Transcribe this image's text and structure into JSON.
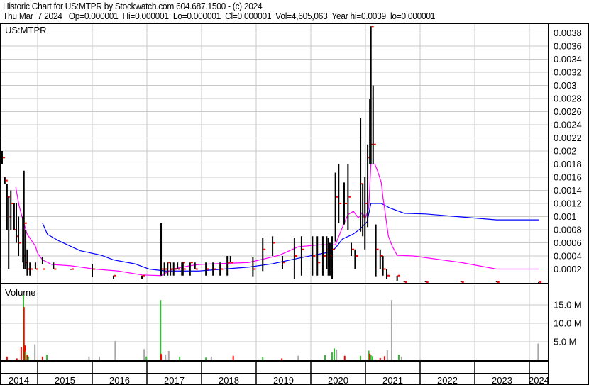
{
  "header": {
    "title": "Historic Chart for US:MTPR by Stockwatch.com 604.687.1500 - (c) 2024",
    "quote": "Thu Mar  7 2024   Op=0.000001  Hi=0.000001  Lo=0.000001  Cl=0.000001  Vol=4,605,063  Year hi=0.0039  lo=0.000001"
  },
  "colors": {
    "bar": "#000000",
    "close": "#ff0000",
    "ma_short": "#ff00ff",
    "ma_long": "#0000ff",
    "vol_up": "#33bb33",
    "vol_down": "#ff0000",
    "vol_flat": "#a8a8a8",
    "grid": "#c8c8c8"
  },
  "chart_data": [
    {
      "type": "bar",
      "title": "US:MTPR",
      "ylim": [
        0,
        0.0039
      ],
      "yticks": [
        "0.0002",
        "0.0004",
        "0.0006",
        "0.0008",
        "0.001",
        "0.0012",
        "0.0014",
        "0.0016",
        "0.0018",
        "0.002",
        "0.0022",
        "0.0024",
        "0.0026",
        "0.0028",
        "0.003",
        "0.0032",
        "0.0034",
        "0.0036",
        "0.0038"
      ],
      "xticks": [
        "2014",
        "2015",
        "2016",
        "2017",
        "2018",
        "2019",
        "2020",
        "2021",
        "2022",
        "2023",
        "2024"
      ],
      "bars_t_high_low_close": [
        [
          2014.35,
          0.002,
          0.0018,
          0.0019
        ],
        [
          2014.4,
          0.0016,
          0.0015,
          0.00155
        ],
        [
          2014.44,
          0.0015,
          0.0008,
          0.0013
        ],
        [
          2014.47,
          0.0013,
          0.0002,
          0.001
        ],
        [
          2014.51,
          0.0014,
          0.0008,
          0.0012
        ],
        [
          2014.57,
          0.0012,
          0.0008,
          0.0008
        ],
        [
          2014.61,
          0.0012,
          0.0006,
          0.0007
        ],
        [
          2014.65,
          0.001,
          0.0004,
          0.0006
        ],
        [
          2014.73,
          0.001,
          0.0003,
          0.0004
        ],
        [
          2014.75,
          0.0017,
          0.0002,
          0.0009
        ],
        [
          2014.78,
          0.0008,
          0.0002,
          0.0003
        ],
        [
          2014.81,
          0.0005,
          0.0001,
          0.0002
        ],
        [
          2014.86,
          0.0003,
          0.0001,
          0.0002
        ],
        [
          2014.96,
          0.0003,
          0.0002,
          0.0002
        ],
        [
          2015.09,
          0.00038,
          0.00027,
          0.0002
        ],
        [
          2015.29,
          0.0003,
          0.0002,
          0.0002
        ],
        [
          2015.61,
          0.0002,
          0.0002,
          0.0002
        ],
        [
          2016.0,
          0.00028,
          8e-05,
          0.0002
        ],
        [
          2016.39,
          0.0001,
          5e-05,
          0.0001
        ],
        [
          2016.91,
          0.0001,
          5e-05,
          0.0001
        ],
        [
          2017.26,
          0.0009,
          0.0001,
          0.0002
        ],
        [
          2017.32,
          0.0003,
          0.0001,
          0.0002
        ],
        [
          2017.38,
          0.0003,
          0.0001,
          0.0003
        ],
        [
          2017.43,
          0.0003,
          0.0001,
          0.0002
        ],
        [
          2017.49,
          0.0003,
          0.0001,
          0.0002
        ],
        [
          2017.56,
          0.0003,
          0.0002,
          0.0002
        ],
        [
          2017.64,
          0.0003,
          0.0001,
          0.0003
        ],
        [
          2017.66,
          0.0003,
          0.0001,
          0.0002
        ],
        [
          2017.79,
          0.0003,
          0.0001,
          0.0003
        ],
        [
          2017.88,
          0.0003,
          0.0002,
          0.0002
        ],
        [
          2018.08,
          0.0003,
          0.0001,
          0.0002
        ],
        [
          2018.21,
          0.0003,
          0.0001,
          0.0002
        ],
        [
          2018.34,
          0.0003,
          0.0001,
          0.0002
        ],
        [
          2018.47,
          0.0004,
          0.0001,
          0.0003
        ],
        [
          2018.53,
          0.0004,
          0.0003,
          0.0003
        ],
        [
          2018.94,
          0.00038,
          9e-05,
          0.0002
        ],
        [
          2019.12,
          0.00068,
          0.00017,
          0.0005
        ],
        [
          2019.3,
          0.0007,
          0.0004,
          0.0006
        ],
        [
          2019.48,
          0.0004,
          0.0002,
          0.0003
        ],
        [
          2019.7,
          0.00068,
          5e-05,
          0.0004
        ],
        [
          2019.83,
          0.0007,
          0.0001,
          0.0005
        ],
        [
          2020.03,
          0.0007,
          0.0001,
          0.0004
        ],
        [
          2020.12,
          0.0007,
          0.0001,
          0.0003
        ],
        [
          2020.22,
          0.0007,
          0.0001,
          0.0004
        ],
        [
          2020.29,
          0.0007,
          0.0002,
          0.0005
        ],
        [
          2020.32,
          0.00068,
          0.0001,
          0.0004
        ],
        [
          2020.35,
          0.0006,
          0.0001,
          0.0004
        ],
        [
          2020.39,
          0.0007,
          5e-05,
          0.0005
        ],
        [
          2020.45,
          0.00167,
          0.00062,
          0.0013
        ],
        [
          2020.51,
          0.0018,
          0.0009,
          0.0012
        ],
        [
          2020.61,
          0.00152,
          0.00088,
          0.0012
        ],
        [
          2020.68,
          0.0018,
          0.0008,
          0.0013
        ],
        [
          2020.74,
          0.0006,
          0.0004,
          0.0005
        ],
        [
          2020.81,
          0.0005,
          0.0002,
          0.0004
        ],
        [
          2020.91,
          0.0025,
          0.00077,
          0.0015
        ],
        [
          2020.95,
          0.0015,
          0.0007,
          0.001
        ],
        [
          2020.99,
          0.0016,
          0.0005,
          0.0012
        ],
        [
          2021.04,
          0.0021,
          0.00084,
          0.0019
        ],
        [
          2021.08,
          0.0028,
          0.0018,
          0.0021
        ],
        [
          2021.1,
          0.0039,
          0.0018,
          0.0039
        ],
        [
          2021.14,
          0.003,
          0.0018,
          0.0021
        ],
        [
          2021.19,
          0.00088,
          9e-05,
          0.0005
        ],
        [
          2021.27,
          0.0005,
          0.0002,
          0.0004
        ],
        [
          2021.32,
          0.0004,
          0.0001,
          0.0002
        ],
        [
          2021.39,
          0.0002,
          5e-05,
          0.0001
        ],
        [
          2021.58,
          0.0001,
          2e-05,
          0.0001
        ],
        [
          2021.71,
          1e-05,
          1e-06,
          1e-06
        ],
        [
          2022.1,
          1e-05,
          1e-06,
          1e-06
        ],
        [
          2022.75,
          1e-05,
          1e-06,
          1e-06
        ],
        [
          2023.4,
          1e-05,
          1e-06,
          1e-06
        ],
        [
          2024.17,
          1e-06,
          1e-06,
          1e-06
        ]
      ],
      "ma_short_t_value": [
        [
          2014.6,
          0.00145
        ],
        [
          2014.66,
          0.00117
        ],
        [
          2014.74,
          0.00092
        ],
        [
          2014.81,
          0.00073
        ],
        [
          2014.96,
          0.00055
        ],
        [
          2015.0,
          0.00044
        ],
        [
          2015.09,
          0.00034
        ],
        [
          2015.26,
          0.00027
        ],
        [
          2015.61,
          0.00025
        ],
        [
          2016.04,
          0.0002
        ],
        [
          2016.48,
          0.00017
        ],
        [
          2016.91,
          0.00011
        ],
        [
          2017.26,
          0.0001
        ],
        [
          2017.47,
          0.0002
        ],
        [
          2017.78,
          0.00025
        ],
        [
          2017.95,
          0.00027
        ],
        [
          2018.86,
          0.0003
        ],
        [
          2019.12,
          0.00035
        ],
        [
          2019.42,
          0.00041
        ],
        [
          2019.77,
          0.00054
        ],
        [
          2020.16,
          0.00057
        ],
        [
          2020.45,
          0.00057
        ],
        [
          2020.58,
          0.00084
        ],
        [
          2020.68,
          0.00103
        ],
        [
          2020.78,
          0.00108
        ],
        [
          2020.87,
          0.00098
        ],
        [
          2020.94,
          0.00106
        ],
        [
          2021.0,
          0.00098
        ],
        [
          2021.06,
          0.00113
        ],
        [
          2021.1,
          0.0018
        ],
        [
          2021.17,
          0.0018
        ],
        [
          2021.22,
          0.0017
        ],
        [
          2021.29,
          0.00152
        ],
        [
          2021.32,
          0.0013
        ],
        [
          2021.42,
          0.0007
        ],
        [
          2021.49,
          0.00055
        ],
        [
          2021.58,
          0.00041
        ],
        [
          2021.88,
          0.0004
        ],
        [
          2022.75,
          0.0003
        ],
        [
          2023.4,
          0.0002
        ],
        [
          2024.18,
          0.0002
        ]
      ],
      "ma_long_t_value": [
        [
          2015.09,
          0.0009
        ],
        [
          2015.18,
          0.00073
        ],
        [
          2015.39,
          0.00063
        ],
        [
          2015.78,
          0.00048
        ],
        [
          2016.17,
          0.00041
        ],
        [
          2016.39,
          0.00034
        ],
        [
          2016.78,
          0.00028
        ],
        [
          2017.04,
          0.0002
        ],
        [
          2017.34,
          0.00017
        ],
        [
          2017.95,
          0.00017
        ],
        [
          2018.86,
          0.00023
        ],
        [
          2019.29,
          0.00028
        ],
        [
          2019.86,
          0.00038
        ],
        [
          2020.29,
          0.00045
        ],
        [
          2020.45,
          0.00052
        ],
        [
          2020.58,
          0.00066
        ],
        [
          2020.77,
          0.00073
        ],
        [
          2020.9,
          0.00081
        ],
        [
          2021.03,
          0.00092
        ],
        [
          2021.1,
          0.0012
        ],
        [
          2021.29,
          0.0012
        ],
        [
          2021.45,
          0.00113
        ],
        [
          2021.71,
          0.00105
        ],
        [
          2022.1,
          0.00104
        ],
        [
          2023.4,
          0.00095
        ],
        [
          2024.18,
          0.00095
        ]
      ]
    },
    {
      "type": "bar",
      "title": "Volume",
      "ylim": [
        0,
        19
      ],
      "yticks": [
        "5.0 M",
        "10.0 M",
        "15.0 M"
      ],
      "ytick_values": [
        5,
        10,
        15
      ],
      "bars_t_millions_dir": [
        [
          2014.44,
          1,
          "down"
        ],
        [
          2014.62,
          0.5,
          "down"
        ],
        [
          2014.7,
          3.5,
          "down"
        ],
        [
          2014.74,
          17.7,
          "up"
        ],
        [
          2014.75,
          14.4,
          "down"
        ],
        [
          2014.77,
          4,
          "down"
        ],
        [
          2014.78,
          2.4,
          "up"
        ],
        [
          2014.81,
          1.5,
          "down"
        ],
        [
          2014.83,
          1,
          "up"
        ],
        [
          2014.95,
          4.3,
          "flat"
        ],
        [
          2015.09,
          1,
          "down"
        ],
        [
          2015.17,
          1.5,
          "up"
        ],
        [
          2015.94,
          1,
          "flat"
        ],
        [
          2016.13,
          1,
          "flat"
        ],
        [
          2016.42,
          5.2,
          "flat"
        ],
        [
          2016.95,
          3,
          "flat"
        ],
        [
          2016.99,
          1,
          "up"
        ],
        [
          2017.25,
          16.3,
          "up"
        ],
        [
          2017.26,
          1.7,
          "down"
        ],
        [
          2017.34,
          1.5,
          "flat"
        ],
        [
          2017.4,
          2.5,
          "flat"
        ],
        [
          2017.6,
          1,
          "up"
        ],
        [
          2018.08,
          0.7,
          "up"
        ],
        [
          2018.18,
          1,
          "flat"
        ],
        [
          2018.58,
          1.2,
          "down"
        ],
        [
          2019.12,
          0.8,
          "up"
        ],
        [
          2019.47,
          0.5,
          "down"
        ],
        [
          2019.77,
          1.2,
          "flat"
        ],
        [
          2020.26,
          1.4,
          "up"
        ],
        [
          2020.39,
          2.1,
          "up"
        ],
        [
          2020.43,
          3.2,
          "up"
        ],
        [
          2020.47,
          2.9,
          "flat"
        ],
        [
          2020.62,
          1.2,
          "down"
        ],
        [
          2020.91,
          1.2,
          "up"
        ],
        [
          2021.06,
          2.6,
          "up"
        ],
        [
          2021.08,
          1.8,
          "down"
        ],
        [
          2021.1,
          1.4,
          "up"
        ],
        [
          2021.13,
          1.1,
          "up"
        ],
        [
          2021.27,
          0.6,
          "down"
        ],
        [
          2021.35,
          1.1,
          "down"
        ],
        [
          2021.4,
          2.7,
          "flat"
        ],
        [
          2021.48,
          16.3,
          "flat"
        ],
        [
          2021.61,
          1.5,
          "up"
        ],
        [
          2021.66,
          1,
          "flat"
        ],
        [
          2024.16,
          4.5,
          "flat"
        ]
      ]
    }
  ]
}
